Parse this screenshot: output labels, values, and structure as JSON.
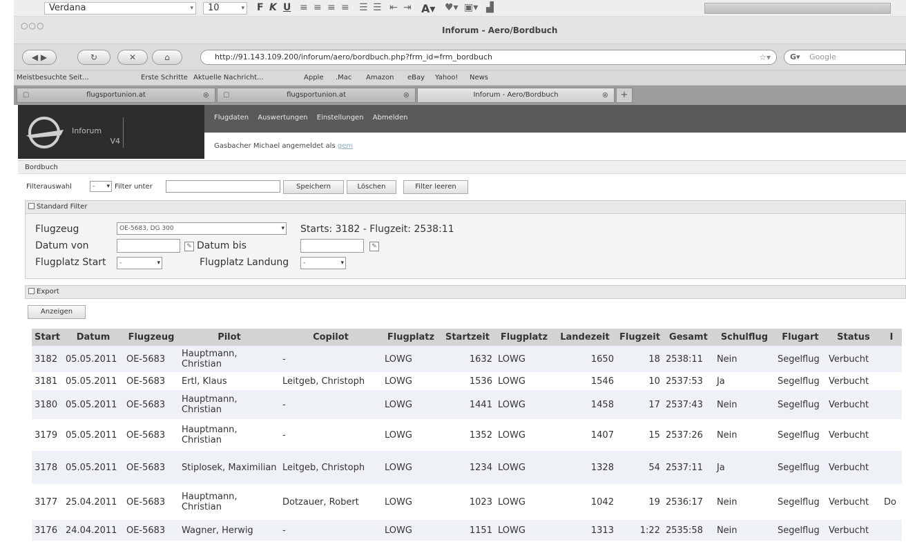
{
  "editor_toolbar": {
    "font_name": "Verdana",
    "font_size": "10",
    "buttons": [
      "F",
      "K",
      "U"
    ]
  },
  "window": {
    "title": "Inforum - Aero/Bordbuch"
  },
  "browser": {
    "url": "http://91.143.109.200/inforum/aero/bordbuch.php?frm_id=frm_bordbuch",
    "search_placeholder": "Google",
    "bookmarks": [
      "Meistbesuchte Seit...",
      "Erste Schritte",
      "Aktuelle Nachricht...",
      "Apple",
      ".Mac",
      "Amazon",
      "eBay",
      "Yahoo!",
      "News"
    ],
    "tabs": [
      {
        "label": "flugsportunion.at"
      },
      {
        "label": "flugsportunion.at"
      },
      {
        "label": "Inforum - Aero/Bordbuch"
      }
    ]
  },
  "app": {
    "logo_line1": "Inforum",
    "logo_line2": "V4",
    "nav": [
      "Flugdaten",
      "Auswertungen",
      "Einstellungen",
      "Abmelden"
    ],
    "login_text": "Gasbacher Michael angemeldet als",
    "login_user": "gem"
  },
  "bordbuch": {
    "section_title": "Bordbuch",
    "filter_select_label": "Filterauswahl",
    "filter_select_value": "-",
    "filter_under_label": "Filter unter",
    "buttons": {
      "save": "Speichern",
      "delete": "Löschen",
      "clear": "Filter leeren"
    },
    "standard_filter_title": "Standard Filter",
    "aircraft_label": "Flugzeug",
    "aircraft_value": "OE-5683, DG 300",
    "summary": "Starts: 3182 - Flugzeit: 2538:11",
    "date_from_label": "Datum von",
    "date_to_label": "Datum bis",
    "airfield_start_label": "Flugplatz Start",
    "airfield_start_value": "-",
    "airfield_landing_label": "Flugplatz Landung",
    "airfield_landing_value": "-",
    "export_title": "Export",
    "show_button": "Anzeigen"
  },
  "table": {
    "headers": [
      "Start",
      "Datum",
      "Flugzeug",
      "Pilot",
      "Copilot",
      "Flugplatz",
      "Startzeit",
      "Flugplatz",
      "Landezeit",
      "Flugzeit",
      "Gesamt",
      "Schulflug",
      "Flugart",
      "Status",
      "I"
    ],
    "rows": [
      [
        "3182",
        "05.05.2011",
        "OE-5683",
        "Hauptmann, Christian",
        "-",
        "LOWG",
        "1632",
        "LOWG",
        "1650",
        "18",
        "2538:11",
        "Nein",
        "Segelflug",
        "Verbucht",
        ""
      ],
      [
        "3181",
        "05.05.2011",
        "OE-5683",
        "Ertl, Klaus",
        "Leitgeb, Christoph",
        "LOWG",
        "1536",
        "LOWG",
        "1546",
        "10",
        "2537:53",
        "Ja",
        "Segelflug",
        "Verbucht",
        ""
      ],
      [
        "3180",
        "05.05.2011",
        "OE-5683",
        "Hauptmann, Christian",
        "-",
        "LOWG",
        "1441",
        "LOWG",
        "1458",
        "17",
        "2537:43",
        "Nein",
        "Segelflug",
        "Verbucht",
        ""
      ],
      [
        "3179",
        "05.05.2011",
        "OE-5683",
        "Hauptmann, Christian",
        "-",
        "LOWG",
        "1352",
        "LOWG",
        "1407",
        "15",
        "2537:26",
        "Nein",
        "Segelflug",
        "Verbucht",
        ""
      ],
      [
        "3178",
        "05.05.2011",
        "OE-5683",
        "Stiplosek, Maximilian",
        "Leitgeb, Christoph",
        "LOWG",
        "1234",
        "LOWG",
        "1328",
        "54",
        "2537:11",
        "Ja",
        "Segelflug",
        "Verbucht",
        ""
      ],
      [
        "3177",
        "25.04.2011",
        "OE-5683",
        "Hauptmann, Christian",
        "Dotzauer, Robert",
        "LOWG",
        "1023",
        "LOWG",
        "1042",
        "19",
        "2536:17",
        "Nein",
        "Segelflug",
        "Verbucht",
        "Do"
      ],
      [
        "3176",
        "24.04.2011",
        "OE-5683",
        "Wagner, Herwig",
        "-",
        "LOWG",
        "1151",
        "LOWG",
        "1313",
        "1:22",
        "2535:58",
        "Nein",
        "Segelflug",
        "Verbucht",
        ""
      ]
    ]
  }
}
